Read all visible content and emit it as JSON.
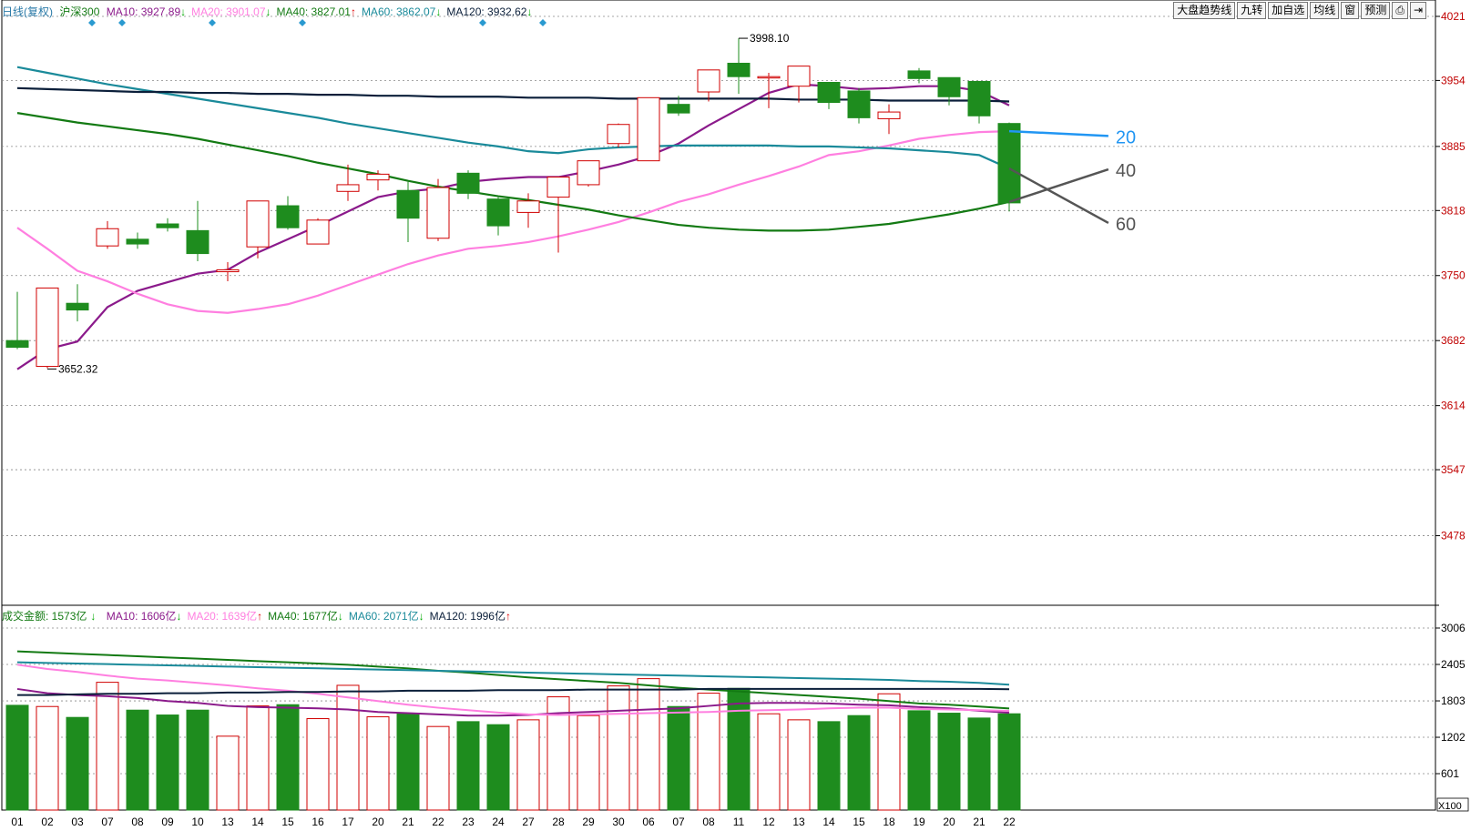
{
  "header_top": {
    "title": "日线(复权)",
    "index_name": "沪深300",
    "ma": [
      {
        "label": "MA10: 3927.89",
        "arrow": "↓",
        "color": "#8b1a8b",
        "arrow_color": "#0a0"
      },
      {
        "label": "MA20: 3901.07",
        "arrow": "↓",
        "color": "#ff7fe0",
        "arrow_color": "#0a0"
      },
      {
        "label": "MA40: 3827.01",
        "arrow": "↑",
        "color": "#137a13",
        "arrow_color": "#d00"
      },
      {
        "label": "MA60: 3862.07",
        "arrow": "↓",
        "color": "#1a8a9a",
        "arrow_color": "#0a0"
      },
      {
        "label": "MA120: 3932.62",
        "arrow": "↓",
        "color": "#0b1f3a",
        "arrow_color": "#0a0"
      }
    ]
  },
  "header_bottom": {
    "title": "成交金额: 1573亿",
    "title_arrow": "↓",
    "ma": [
      {
        "label": "MA10: 1606亿",
        "arrow": "↓",
        "color": "#8b1a8b",
        "arrow_color": "#0a0"
      },
      {
        "label": "MA20: 1639亿",
        "arrow": "↑",
        "color": "#ff7fe0",
        "arrow_color": "#d00"
      },
      {
        "label": "MA40: 1677亿",
        "arrow": "↓",
        "color": "#137a13",
        "arrow_color": "#0a0"
      },
      {
        "label": "MA60: 2071亿",
        "arrow": "↓",
        "color": "#1a8a9a",
        "arrow_color": "#0a0"
      },
      {
        "label": "MA120: 1996亿",
        "arrow": "↑",
        "color": "#0b1f3a",
        "arrow_color": "#d00"
      }
    ]
  },
  "toolbar": [
    "大盘趋势线",
    "九转",
    "加自选",
    "均线",
    "窗",
    "预测",
    "⎙",
    "⇥"
  ],
  "colors": {
    "up": "#d00000",
    "down": "#1e8c1e",
    "axis_text": "#c00000",
    "grid": "#888888"
  },
  "chart_data": {
    "type": "candlestick",
    "x_labels": [
      "01",
      "02",
      "03",
      "07",
      "08",
      "09",
      "10",
      "13",
      "14",
      "15",
      "16",
      "17",
      "20",
      "21",
      "22",
      "23",
      "24",
      "27",
      "28",
      "29",
      "30",
      "06",
      "07",
      "08",
      "11",
      "12",
      "13",
      "14",
      "15",
      "18",
      "19",
      "20",
      "21",
      "22"
    ],
    "price_axis": {
      "ticks": [
        4021,
        3954,
        3885,
        3818,
        3750,
        3682,
        3614,
        3547,
        3478
      ],
      "ylim": [
        3410,
        4021
      ]
    },
    "volume_axis": {
      "ticks": [
        3006,
        2405,
        1803,
        1202,
        601
      ],
      "unit": "X100",
      "ylim": [
        0,
        3006
      ]
    },
    "candles": [
      {
        "o": 3682,
        "h": 3733,
        "l": 3673,
        "c": 3675
      },
      {
        "o": 3655,
        "h": 3737,
        "l": 3653,
        "c": 3737
      },
      {
        "o": 3721,
        "h": 3741,
        "l": 3702,
        "c": 3714
      },
      {
        "o": 3781,
        "h": 3807,
        "l": 3778,
        "c": 3799
      },
      {
        "o": 3788,
        "h": 3795,
        "l": 3778,
        "c": 3783
      },
      {
        "o": 3804,
        "h": 3810,
        "l": 3796,
        "c": 3800
      },
      {
        "o": 3797,
        "h": 3828,
        "l": 3765,
        "c": 3773
      },
      {
        "o": 3754,
        "h": 3764,
        "l": 3744,
        "c": 3756
      },
      {
        "o": 3780,
        "h": 3828,
        "l": 3768,
        "c": 3828
      },
      {
        "o": 3823,
        "h": 3833,
        "l": 3798,
        "c": 3800
      },
      {
        "o": 3783,
        "h": 3810,
        "l": 3783,
        "c": 3808
      },
      {
        "o": 3838,
        "h": 3866,
        "l": 3828,
        "c": 3845
      },
      {
        "o": 3850,
        "h": 3860,
        "l": 3839,
        "c": 3856
      },
      {
        "o": 3839,
        "h": 3848,
        "l": 3785,
        "c": 3810
      },
      {
        "o": 3789,
        "h": 3851,
        "l": 3786,
        "c": 3842
      },
      {
        "o": 3857,
        "h": 3860,
        "l": 3830,
        "c": 3836
      },
      {
        "o": 3830,
        "h": 3832,
        "l": 3792,
        "c": 3802
      },
      {
        "o": 3816,
        "h": 3836,
        "l": 3800,
        "c": 3828
      },
      {
        "o": 3832,
        "h": 3853,
        "l": 3774,
        "c": 3853
      },
      {
        "o": 3845,
        "h": 3870,
        "l": 3843,
        "c": 3870
      },
      {
        "o": 3888,
        "h": 3909,
        "l": 3884,
        "c": 3908
      },
      {
        "o": 3870,
        "h": 3936,
        "l": 3870,
        "c": 3936
      },
      {
        "o": 3929,
        "h": 3938,
        "l": 3917,
        "c": 3920
      },
      {
        "o": 3942,
        "h": 3965,
        "l": 3932,
        "c": 3965
      },
      {
        "o": 3972,
        "h": 3998,
        "l": 3940,
        "c": 3958
      },
      {
        "o": 3958,
        "h": 3962,
        "l": 3925,
        "c": 3958
      },
      {
        "o": 3948,
        "h": 3966,
        "l": 3931,
        "c": 3969
      },
      {
        "o": 3952,
        "h": 3952,
        "l": 3924,
        "c": 3931
      },
      {
        "o": 3943,
        "h": 3946,
        "l": 3909,
        "c": 3915
      },
      {
        "o": 3914,
        "h": 3929,
        "l": 3898,
        "c": 3921
      },
      {
        "o": 3964,
        "h": 3967,
        "l": 3951,
        "c": 3956
      },
      {
        "o": 3957,
        "h": 3957,
        "l": 3928,
        "c": 3937
      },
      {
        "o": 3953,
        "h": 3953,
        "l": 3909,
        "c": 3917
      },
      {
        "o": 3909,
        "h": 3910,
        "l": 3817,
        "c": 3826
      }
    ],
    "volume": [
      1730,
      1710,
      1530,
      2110,
      1650,
      1570,
      1650,
      1220,
      1720,
      1740,
      1510,
      2060,
      1540,
      1590,
      1380,
      1460,
      1410,
      1490,
      1870,
      1560,
      2050,
      2170,
      1710,
      1930,
      2010,
      1590,
      1490,
      1460,
      1560,
      1920,
      1640,
      1600,
      1520,
      1590
    ],
    "ma_price": [
      {
        "name": "MA10",
        "color": "#8b1a8b",
        "values": [
          3652,
          3673,
          3681,
          3717,
          3734,
          3743,
          3752,
          3756,
          3774,
          3788,
          3802,
          3817,
          3832,
          3838,
          3841,
          3848,
          3851,
          3853,
          3853,
          3859,
          3866,
          3875,
          3888,
          3907,
          3924,
          3941,
          3950,
          3948,
          3945,
          3946,
          3948,
          3948,
          3943,
          3928
        ]
      },
      {
        "name": "MA20",
        "color": "#ff7fe0",
        "values": [
          3800,
          3778,
          3755,
          3744,
          3731,
          3720,
          3713,
          3711,
          3715,
          3720,
          3729,
          3740,
          3751,
          3762,
          3771,
          3778,
          3781,
          3785,
          3791,
          3798,
          3806,
          3816,
          3827,
          3835,
          3845,
          3854,
          3864,
          3876,
          3880,
          3886,
          3893,
          3897,
          3900,
          3901
        ]
      },
      {
        "name": "MA40",
        "color": "#137a13",
        "values": [
          3920,
          3915,
          3910,
          3906,
          3902,
          3898,
          3893,
          3887,
          3881,
          3875,
          3868,
          3862,
          3856,
          3849,
          3843,
          3838,
          3833,
          3829,
          3824,
          3819,
          3813,
          3808,
          3803,
          3800,
          3798,
          3797,
          3797,
          3798,
          3801,
          3804,
          3809,
          3814,
          3820,
          3827
        ]
      },
      {
        "name": "MA60",
        "color": "#1a8a9a",
        "values": [
          3968,
          3962,
          3956,
          3950,
          3945,
          3940,
          3935,
          3930,
          3925,
          3920,
          3915,
          3909,
          3904,
          3899,
          3894,
          3889,
          3885,
          3880,
          3878,
          3882,
          3884,
          3885,
          3886,
          3886,
          3886,
          3886,
          3885,
          3885,
          3884,
          3883,
          3881,
          3879,
          3876,
          3862
        ]
      },
      {
        "name": "MA120",
        "color": "#0b1f3a",
        "values": [
          3946,
          3945,
          3944,
          3943,
          3942,
          3942,
          3941,
          3941,
          3940,
          3940,
          3939,
          3939,
          3938,
          3938,
          3937,
          3937,
          3937,
          3936,
          3936,
          3936,
          3935,
          3935,
          3935,
          3935,
          3935,
          3935,
          3934,
          3934,
          3934,
          3933,
          3933,
          3933,
          3933,
          3932
        ]
      }
    ],
    "ma_volume": [
      {
        "name": "MA10",
        "color": "#8b1a8b",
        "values": [
          2000,
          1930,
          1900,
          1880,
          1850,
          1800,
          1770,
          1720,
          1700,
          1690,
          1680,
          1660,
          1620,
          1600,
          1580,
          1560,
          1560,
          1570,
          1600,
          1620,
          1640,
          1660,
          1680,
          1720,
          1760,
          1770,
          1770,
          1760,
          1740,
          1730,
          1700,
          1680,
          1640,
          1606
        ]
      },
      {
        "name": "MA20",
        "color": "#ff7fe0",
        "values": [
          2400,
          2330,
          2280,
          2220,
          2170,
          2140,
          2100,
          2060,
          2010,
          1970,
          1920,
          1860,
          1800,
          1740,
          1690,
          1650,
          1610,
          1580,
          1570,
          1580,
          1590,
          1600,
          1610,
          1620,
          1640,
          1650,
          1660,
          1680,
          1690,
          1690,
          1670,
          1660,
          1650,
          1639
        ]
      },
      {
        "name": "MA40",
        "color": "#137a13",
        "values": [
          2620,
          2600,
          2580,
          2560,
          2540,
          2520,
          2500,
          2480,
          2460,
          2440,
          2420,
          2400,
          2370,
          2340,
          2300,
          2270,
          2230,
          2190,
          2160,
          2130,
          2100,
          2060,
          2020,
          1990,
          1960,
          1930,
          1900,
          1870,
          1840,
          1800,
          1760,
          1740,
          1710,
          1677
        ]
      },
      {
        "name": "MA60",
        "color": "#1a8a9a",
        "values": [
          2440,
          2430,
          2420,
          2410,
          2400,
          2390,
          2380,
          2370,
          2360,
          2350,
          2340,
          2330,
          2320,
          2310,
          2300,
          2290,
          2280,
          2270,
          2260,
          2250,
          2240,
          2230,
          2220,
          2210,
          2200,
          2190,
          2180,
          2170,
          2160,
          2150,
          2130,
          2120,
          2100,
          2071
        ]
      },
      {
        "name": "MA120",
        "color": "#0b1f3a",
        "values": [
          1900,
          1900,
          1910,
          1920,
          1920,
          1930,
          1930,
          1940,
          1940,
          1950,
          1950,
          1960,
          1960,
          1970,
          1970,
          1970,
          1980,
          1980,
          1980,
          1990,
          1990,
          1990,
          1990,
          2000,
          2000,
          2000,
          2000,
          2000,
          2000,
          2000,
          2000,
          2000,
          2000,
          1996
        ]
      }
    ],
    "projections": [
      {
        "label": "20",
        "color": "#2196f3",
        "from_index": 33,
        "from_value": 3901,
        "to_index": 36.3,
        "to_value": 3896
      },
      {
        "label": "40",
        "color": "#555555",
        "from_index": 33,
        "from_value": 3827,
        "to_index": 36.3,
        "to_value": 3861
      },
      {
        "label": "60",
        "color": "#555555",
        "from_index": 33,
        "from_value": 3862,
        "to_index": 36.3,
        "to_value": 3805
      }
    ],
    "annotations": [
      {
        "text": "3998.10",
        "index": 24,
        "value": 3998.1,
        "side": "right"
      },
      {
        "text": "3652.32",
        "index": 1,
        "value": 3652.32,
        "side": "right"
      }
    ],
    "markers": [
      2,
      3,
      6,
      9,
      15,
      17
    ]
  }
}
